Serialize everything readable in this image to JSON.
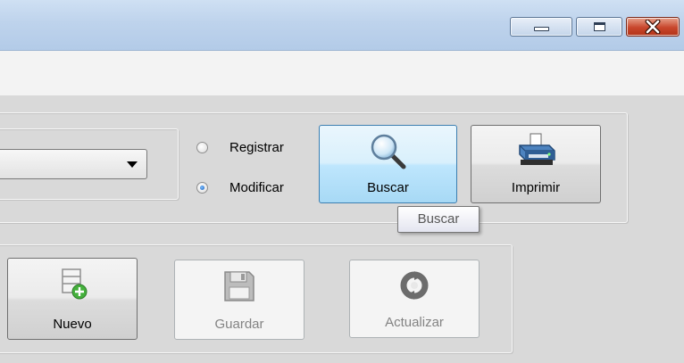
{
  "window": {
    "minimize_icon": "minimize-icon",
    "maximize_icon": "maximize-icon",
    "close_icon": "close-icon"
  },
  "search_group": {
    "combo_value": "",
    "radio_registrar": "Registrar",
    "radio_modificar": "Modificar",
    "selected_mode": "Modificar",
    "buscar_label": "Buscar",
    "imprimir_label": "Imprimir",
    "tooltip": "Buscar"
  },
  "actions_group": {
    "nuevo_label": "Nuevo",
    "guardar_label": "Guardar",
    "actualizar_label": "Actualizar"
  },
  "colors": {
    "form_background": "#d9d9d9",
    "title_bar": "#bed3ec",
    "close_button": "#c8462c",
    "hover_button": "#bee6fd",
    "disabled_text": "#838383"
  }
}
